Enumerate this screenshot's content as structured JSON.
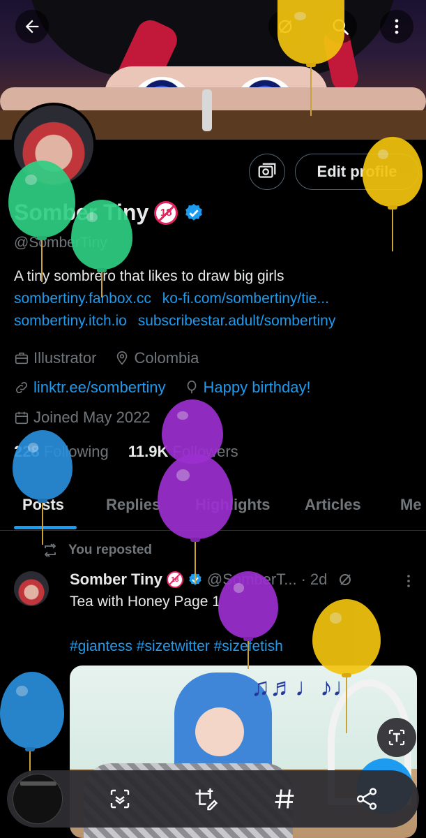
{
  "profile": {
    "display_name": "Somber Tiny",
    "handle": "@SomberTiny",
    "adult_badge": "18",
    "bio": "A tiny sombrero that likes to draw big girls",
    "links": [
      [
        "sombertiny.fanbox.cc",
        "ko-fi.com/sombertiny/tie..."
      ],
      [
        "sombertiny.itch.io",
        "subscribestar.adult/sombertiny"
      ]
    ],
    "profession": "Illustrator",
    "location": "Colombia",
    "website": "linktr.ee/sombertiny",
    "birthday": "Happy birthday!",
    "joined": "Joined May 2022",
    "following_count": "228",
    "following_label": "Following",
    "followers_count": "11.9K",
    "followers_label": "Followers",
    "edit_profile_label": "Edit profile"
  },
  "tabs": [
    "Posts",
    "Replies",
    "Highlights",
    "Articles",
    "Me"
  ],
  "active_tab": "Posts",
  "post": {
    "repost_label": "You reposted",
    "author_name": "Somber Tiny",
    "author_handle": "@SomberT...",
    "separator": "·",
    "time": "2d",
    "text": "Tea with Honey Page 1",
    "hashtags": "#giantess #sizetwitter #sizefetish"
  },
  "colors": {
    "accent": "#1d9bf0",
    "muted": "#71767b",
    "text": "#e7e9ea",
    "balloon_green": "#2fcf84",
    "balloon_yellow": "#f2c40f",
    "balloon_purple": "#9c2fd0",
    "balloon_blue": "#2a8fdc"
  },
  "icons": {
    "back": "arrow-left-icon",
    "grok": "grok-icon",
    "search": "search-icon",
    "more": "more-vertical-icon",
    "professional": "briefcase-icon",
    "location": "location-pin-icon",
    "link": "link-icon",
    "birthday": "balloon-icon",
    "calendar": "calendar-icon",
    "repost": "repost-icon",
    "capture_tools": [
      "scan-text-icon",
      "crop-edit-icon",
      "hashtag-icon",
      "share-icon"
    ]
  }
}
